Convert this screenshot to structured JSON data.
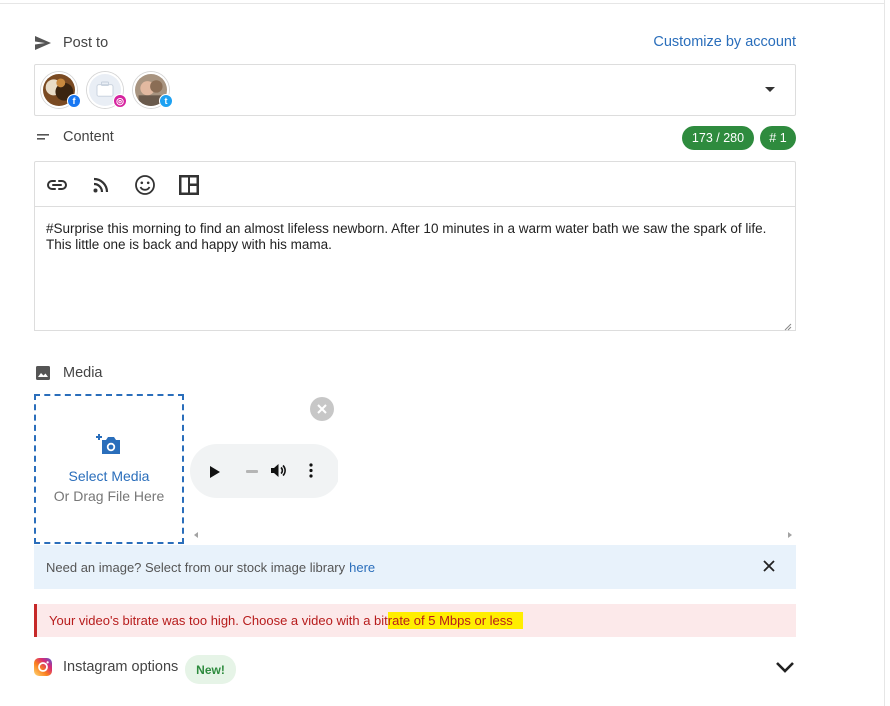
{
  "post_to": {
    "label": "Post to",
    "customize_link": "Customize by account",
    "accounts": [
      {
        "network": "facebook",
        "badge_color": "#1877f2"
      },
      {
        "network": "instagram",
        "badge_color": "#d6249f"
      },
      {
        "network": "twitter",
        "badge_color": "#1da1f2"
      }
    ]
  },
  "content": {
    "label": "Content",
    "char_count": "173 / 280",
    "post_number": "# 1",
    "toolbar": [
      "link-icon",
      "rss-icon",
      "emoji-icon",
      "layout-icon"
    ],
    "text": "#Surprise this morning to find an almost lifeless newborn.  After 10 minutes in a warm water bath we saw the spark of life.  This little one is back and happy with his mama."
  },
  "media": {
    "label": "Media",
    "select_label": "Select Media",
    "drag_label": "Or Drag File Here"
  },
  "stock_banner": {
    "text": "Need an image? Select from our stock image library",
    "link": "here"
  },
  "error": {
    "text_plain": "Your video's bitrate was too high. Choose a video with a bit",
    "text_highlighted": "rate of 5 Mbps or less"
  },
  "instagram_options": {
    "label": "Instagram options",
    "badge": "New!"
  },
  "colors": {
    "accent": "#2a6ebb",
    "success": "#2e8b3e",
    "error": "#c62828",
    "highlight": "#ffee00"
  }
}
